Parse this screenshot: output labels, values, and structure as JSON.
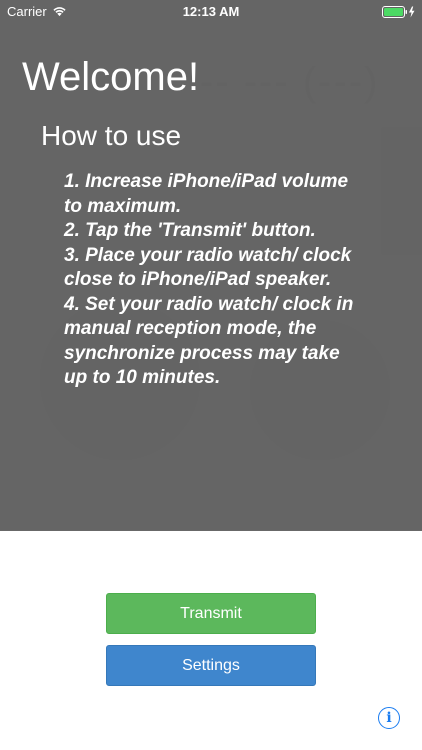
{
  "status_bar": {
    "carrier": "Carrier",
    "time": "12:13 AM"
  },
  "background": {
    "time_display": "-- --- (---)"
  },
  "welcome": {
    "title": "Welcome!",
    "heading": "How to use",
    "steps": [
      "1. Increase iPhone/iPad volume to maximum.",
      "2. Tap the 'Transmit' button.",
      "3. Place your radio watch/ clock close to iPhone/iPad speaker.",
      "4. Set your radio watch/ clock in manual reception mode, the synchronize process may take up to 10 minutes."
    ]
  },
  "buttons": {
    "transmit": "Transmit",
    "settings": "Settings",
    "info": "i"
  },
  "colors": {
    "transmit": "#5cb85c",
    "settings": "#3f86cd",
    "info": "#1a7cf0",
    "overlay": "#5c5c5c",
    "battery": "#4cd964"
  }
}
